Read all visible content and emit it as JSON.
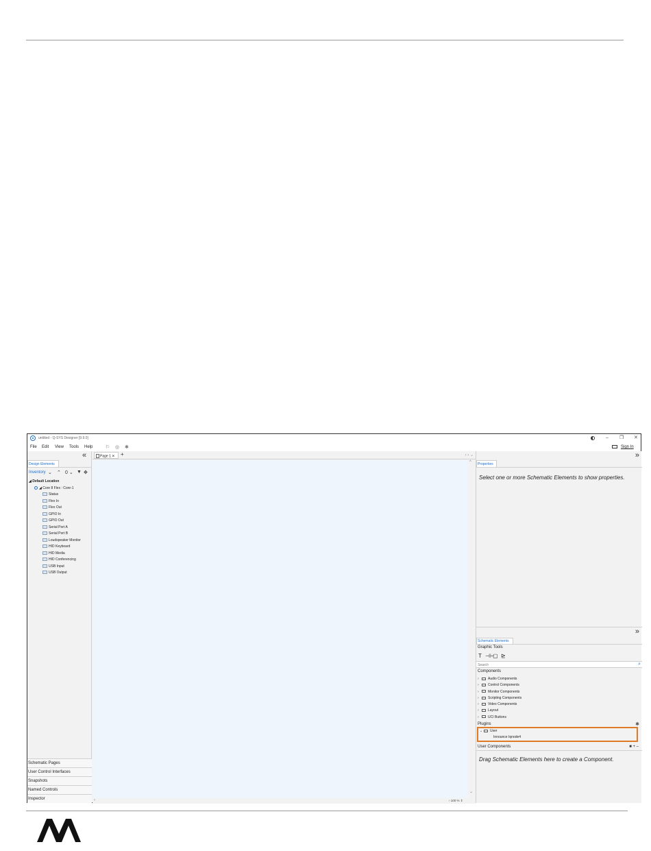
{
  "app": {
    "title": "untitled - Q-SYS Designer [9.9.0]",
    "window_controls": [
      "–",
      "❐",
      "✕"
    ],
    "menu": [
      "File",
      "Edit",
      "View",
      "Tools",
      "Help"
    ],
    "sign_in": "Sign In"
  },
  "left_panel": {
    "collapse": "«",
    "tab": "Design Elements",
    "inventory_label": "Inventory",
    "inventory_tools": [
      "⌄",
      "⌃",
      "0 ⌄",
      "▼",
      "✥"
    ],
    "root": "◢ Default Location",
    "core": "◢ Core 8 Flex : Core-1",
    "leaves": [
      "Status",
      "Flex In",
      "Flex Out",
      "GPIO In",
      "GPIO Out",
      "Serial Port A",
      "Serial Port B",
      "Loudspeaker Monitor",
      "HID Keyboard",
      "HID Media",
      "HID Conferencing",
      "USB Input",
      "USB Output"
    ],
    "footer": [
      "Schematic Pages",
      "User Control Interfaces",
      "Snapshots",
      "Named Controls",
      "Inspector"
    ]
  },
  "center": {
    "tab_label": "Page 1",
    "tab_close": "✕",
    "add_tab": "+",
    "nav": "‹ › ⌄",
    "scroll_up": "^",
    "scroll_down": "⌄",
    "scroll_left": "‹",
    "zoom": "› 100 % ⇕"
  },
  "right_panel": {
    "collapse": "»",
    "properties_tab": "Properties",
    "properties_message": "Select one or more Schematic Elements to show properties.",
    "schematic_tab": "Schematic Elements",
    "graphic_tools_label": "Graphic Tools",
    "graphic_tools": [
      "T",
      "⊣⊢",
      "▢",
      "⊵"
    ],
    "search_placeholder": "Search",
    "components_label": "Components",
    "components": [
      "Audio Components",
      "Control Components",
      "Monitor Components",
      "Scripting Components",
      "Video Components",
      "Layout",
      "UCI Buttons"
    ],
    "plugins_label": "Plugins",
    "plugin_user": "User",
    "plugin_item": "Innounce Iqnode4",
    "user_components_label": "User Components",
    "user_components_icons": "■ + –",
    "user_components_message": "Drag Schematic Elements here to create a Component."
  },
  "colors": {
    "accent": "#1b6fd1",
    "highlight": "#e07a26",
    "canvas": "#eef5fc"
  }
}
